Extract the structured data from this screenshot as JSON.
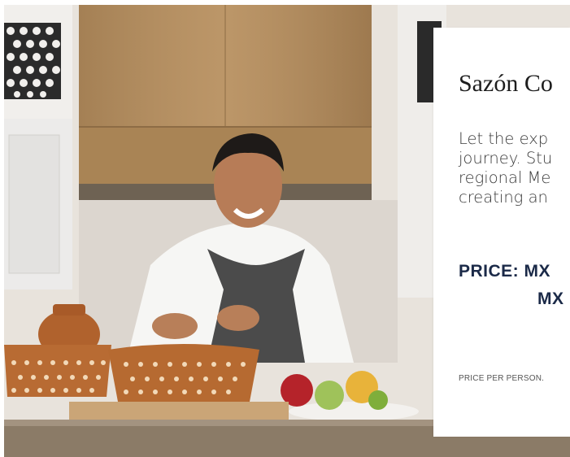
{
  "photo": {
    "subject": "chef-cooking-image",
    "colors": {
      "wall": "#e6e1db",
      "hood": "#b08a5c",
      "clay": "#b5652e",
      "apron": "#4a4a4a",
      "counter": "#8a7a66"
    }
  },
  "card": {
    "title": "Sazón Co",
    "description_lines": [
      "Let the exp",
      "journey. Stu",
      "regional Me",
      "creating an"
    ],
    "price_line1": "PRICE: MX",
    "price_line2": "MX",
    "price_note": "PRICE PER PERSON."
  }
}
